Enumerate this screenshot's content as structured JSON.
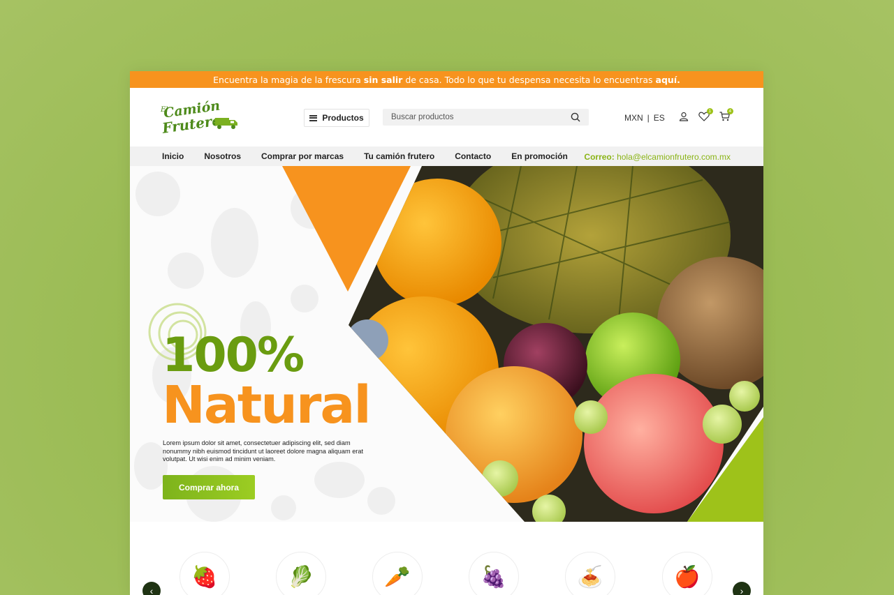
{
  "announcement": {
    "part1": "Encuentra la magia de la frescura ",
    "bold1": "sin salir",
    "part2": " de casa. Todo lo que tu despensa necesita lo encuentras ",
    "bold2": "aquí."
  },
  "logo": {
    "line0": "El",
    "line1": "Camión",
    "line2": "Frutero"
  },
  "header": {
    "products_label": "Productos",
    "search_placeholder": "Buscar productos",
    "currency": "MXN",
    "separator": "|",
    "language": "ES",
    "wishlist_count": "1",
    "cart_count": "4"
  },
  "nav": {
    "items": [
      "Inicio",
      "Nosotros",
      "Comprar por marcas",
      "Tu camión frutero",
      "Contacto",
      "En promoción"
    ],
    "mail_label": "Correo:",
    "mail_value": " hola@elcamionfrutero.com.mx"
  },
  "hero": {
    "title1": "100%",
    "title2": "Natural",
    "text": "Lorem ipsum dolor sit amet, consectetuer adipiscing elit, sed diam nonummy nibh euismod tincidunt ut laoreet dolore magna aliquam erat volutpat. Ut wisi enim ad minim veniam.",
    "cta": "Comprar ahora"
  },
  "categories": [
    {
      "icon": "mixed-fruit-icon",
      "glyph": "🍓"
    },
    {
      "icon": "lettuce-icon",
      "glyph": "🥬"
    },
    {
      "icon": "vegetable-crate-icon",
      "glyph": "🥕"
    },
    {
      "icon": "grapes-icon",
      "glyph": "🍇"
    },
    {
      "icon": "pasta-icon",
      "glyph": "🍝"
    },
    {
      "icon": "apple-icon",
      "glyph": "🍎"
    }
  ],
  "colors": {
    "orange": "#f7931e",
    "green": "#6a9c10",
    "lime": "#9ec21a",
    "background": "#9bbc55"
  }
}
